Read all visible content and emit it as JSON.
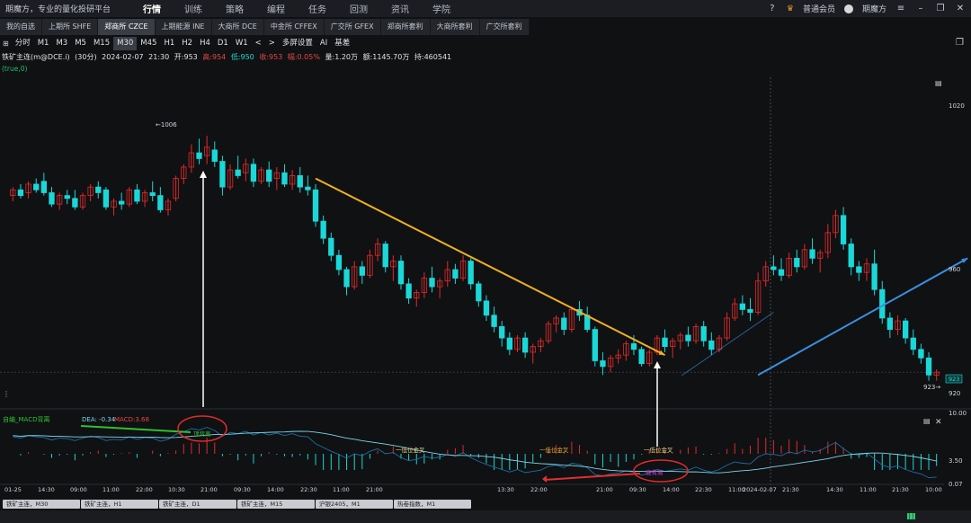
{
  "app": {
    "brand": "期魔方，专业的量化投研平台",
    "menu": [
      "行情",
      "训练",
      "策略",
      "编程",
      "任务",
      "回测",
      "资讯",
      "学院"
    ],
    "active_menu": "行情",
    "membership": "普通会员",
    "username": "期魔方"
  },
  "exchange_tabs": [
    "我的自选",
    "上期所 SHFE",
    "郑商所 CZCE",
    "上期能源 INE",
    "大商所 DCE",
    "中金所 CFFEX",
    "广交所 GFEX",
    "郑商所套利",
    "大商所套利",
    "广交所套利"
  ],
  "active_exchange_tab": "郑商所 CZCE",
  "periods": [
    "分时",
    "M1",
    "M3",
    "M5",
    "M15",
    "M30",
    "M45",
    "H1",
    "H2",
    "H4",
    "D1",
    "W1"
  ],
  "active_period": "M30",
  "period_extras": {
    "prev": "<",
    "next": ">",
    "multi": "多屏设置",
    "ai": "AI",
    "spread": "基差"
  },
  "quote": {
    "symbol": "铁矿主连(m@DCE.i)",
    "interval": "(30分)",
    "date": "2024-02-07",
    "time": "21:30",
    "open_label": "开:953",
    "high_label": "高:954",
    "low_label": "低:950",
    "close_label": "收:953",
    "change_label": "幅:0.05%",
    "volume_label": "量:1.20万",
    "amount_label": "额:1145.70万",
    "oi_label": "持:460541"
  },
  "params_label": "(true,0)",
  "price_axis": {
    "labels": [
      "1020",
      "960",
      "920"
    ],
    "last_tag": "923",
    "low_marker": "923",
    "high_marker": "←1006"
  },
  "indicator": {
    "name": "自编_MACD背离",
    "dea_label": "DEA: -0.34",
    "macd_label": "MACD:3.68",
    "axis_labels": [
      "10.00",
      "3.50",
      "0.07"
    ],
    "annotations": [
      "顶背离",
      "一低位金叉",
      "一低位金叉",
      "一低位金叉",
      "底背离"
    ]
  },
  "time_axis": [
    "01-25",
    "14:30",
    "09:00",
    "11:00",
    "22:00",
    "10:30",
    "21:00",
    "09:30",
    "14:00",
    "22:30",
    "11:00",
    "21:00",
    "13:30",
    "22:00",
    "21:00",
    "09:30",
    "14:00",
    "22:30",
    "11:00",
    "2024-02-07",
    "21:30",
    "14:30",
    "11:00",
    "21:30",
    "10:00"
  ],
  "bottom_tabs": [
    "铁矿主连，M30",
    "铁矿主连，H1",
    "铁矿主连，D1",
    "铁矿主连，M15",
    "沪银2405，M1",
    "热卷指数，M1"
  ],
  "colors": {
    "up": "#e02b2b",
    "down": "#1ad8d8",
    "bg": "#101113",
    "accent": "#2f9ad0"
  },
  "chart_data": {
    "type": "candlestick",
    "title": "铁矿主连(m@DCE.i) (30分)",
    "ylim": [
      918,
      1024
    ],
    "candles": [
      [
        985,
        988,
        983,
        987
      ],
      [
        987,
        989,
        984,
        985
      ],
      [
        986,
        990,
        984,
        989
      ],
      [
        989,
        991,
        986,
        987
      ],
      [
        990,
        993,
        985,
        986
      ],
      [
        986,
        988,
        981,
        982
      ],
      [
        982,
        986,
        980,
        985
      ],
      [
        985,
        987,
        982,
        984
      ],
      [
        984,
        987,
        980,
        981
      ],
      [
        981,
        986,
        980,
        985
      ],
      [
        985,
        989,
        983,
        988
      ],
      [
        988,
        990,
        984,
        986
      ],
      [
        987,
        988,
        980,
        981
      ],
      [
        981,
        984,
        978,
        983
      ],
      [
        983,
        986,
        980,
        982
      ],
      [
        982,
        988,
        981,
        987
      ],
      [
        987,
        989,
        982,
        983
      ],
      [
        983,
        987,
        981,
        986
      ],
      [
        986,
        990,
        983,
        985
      ],
      [
        985,
        988,
        979,
        980
      ],
      [
        980,
        984,
        978,
        983
      ],
      [
        984,
        992,
        983,
        991
      ],
      [
        991,
        996,
        989,
        995
      ],
      [
        995,
        1003,
        993,
        1000
      ],
      [
        1000,
        1005,
        996,
        998
      ],
      [
        999,
        1006,
        996,
        1002
      ],
      [
        1001,
        1004,
        995,
        997
      ],
      [
        997,
        999,
        985,
        988
      ],
      [
        988,
        996,
        987,
        994
      ],
      [
        994,
        999,
        991,
        992
      ],
      [
        993,
        998,
        990,
        996
      ],
      [
        996,
        998,
        988,
        990
      ],
      [
        990,
        995,
        989,
        994
      ],
      [
        994,
        997,
        988,
        990
      ],
      [
        991,
        995,
        987,
        993
      ],
      [
        993,
        996,
        988,
        989
      ],
      [
        989,
        994,
        987,
        992
      ],
      [
        992,
        995,
        986,
        988
      ],
      [
        988,
        992,
        985,
        987
      ],
      [
        987,
        989,
        974,
        976
      ],
      [
        976,
        978,
        968,
        970
      ],
      [
        970,
        972,
        962,
        964
      ],
      [
        964,
        966,
        957,
        959
      ],
      [
        959,
        960,
        950,
        953
      ],
      [
        953,
        962,
        952,
        960
      ],
      [
        960,
        962,
        954,
        957
      ],
      [
        957,
        966,
        956,
        964
      ],
      [
        964,
        970,
        962,
        968
      ],
      [
        968,
        969,
        958,
        960
      ],
      [
        960,
        964,
        955,
        962
      ],
      [
        962,
        964,
        952,
        954
      ],
      [
        954,
        956,
        947,
        949
      ],
      [
        949,
        952,
        946,
        951
      ],
      [
        951,
        958,
        949,
        956
      ],
      [
        956,
        960,
        951,
        953
      ],
      [
        953,
        956,
        949,
        955
      ],
      [
        955,
        962,
        953,
        959
      ],
      [
        959,
        961,
        954,
        956
      ],
      [
        956,
        964,
        955,
        962
      ],
      [
        962,
        963,
        952,
        954
      ],
      [
        954,
        955,
        946,
        948
      ],
      [
        948,
        950,
        941,
        943
      ],
      [
        943,
        946,
        937,
        939
      ],
      [
        939,
        941,
        932,
        935
      ],
      [
        935,
        937,
        929,
        931
      ],
      [
        931,
        936,
        930,
        935
      ],
      [
        935,
        937,
        928,
        930
      ],
      [
        930,
        933,
        926,
        932
      ],
      [
        932,
        935,
        930,
        934
      ],
      [
        934,
        941,
        933,
        940
      ],
      [
        940,
        943,
        937,
        942
      ],
      [
        942,
        944,
        936,
        938
      ],
      [
        938,
        946,
        937,
        945
      ],
      [
        945,
        948,
        941,
        943
      ],
      [
        943,
        946,
        937,
        938
      ],
      [
        938,
        939,
        925,
        927
      ],
      [
        927,
        930,
        922,
        925
      ],
      [
        925,
        929,
        923,
        928
      ],
      [
        928,
        931,
        926,
        929
      ],
      [
        929,
        934,
        927,
        933
      ],
      [
        933,
        936,
        929,
        931
      ],
      [
        931,
        932,
        925,
        926
      ],
      [
        926,
        931,
        925,
        930
      ],
      [
        930,
        936,
        929,
        935
      ],
      [
        935,
        938,
        930,
        932
      ],
      [
        932,
        935,
        928,
        934
      ],
      [
        934,
        937,
        931,
        936
      ],
      [
        936,
        939,
        932,
        934
      ],
      [
        934,
        940,
        933,
        939
      ],
      [
        939,
        941,
        932,
        934
      ],
      [
        934,
        937,
        929,
        931
      ],
      [
        931,
        936,
        930,
        935
      ],
      [
        935,
        944,
        934,
        942
      ],
      [
        942,
        949,
        941,
        947
      ],
      [
        947,
        950,
        943,
        945
      ],
      [
        945,
        949,
        941,
        944
      ],
      [
        944,
        958,
        943,
        955
      ],
      [
        955,
        962,
        953,
        960
      ],
      [
        960,
        964,
        957,
        959
      ],
      [
        959,
        963,
        955,
        957
      ],
      [
        957,
        965,
        956,
        963
      ],
      [
        963,
        966,
        958,
        960
      ],
      [
        960,
        968,
        959,
        966
      ],
      [
        966,
        970,
        961,
        963
      ],
      [
        963,
        966,
        958,
        965
      ],
      [
        965,
        975,
        963,
        972
      ],
      [
        972,
        980,
        970,
        978
      ],
      [
        978,
        981,
        966,
        968
      ],
      [
        968,
        970,
        957,
        960
      ],
      [
        960,
        962,
        955,
        958
      ],
      [
        958,
        963,
        955,
        961
      ],
      [
        961,
        966,
        950,
        952
      ],
      [
        952,
        955,
        940,
        942
      ],
      [
        942,
        944,
        935,
        938
      ],
      [
        938,
        943,
        936,
        941
      ],
      [
        941,
        942,
        933,
        935
      ],
      [
        935,
        938,
        929,
        931
      ],
      [
        931,
        933,
        926,
        928
      ],
      [
        928,
        930,
        920,
        922
      ],
      [
        922,
        924,
        920,
        923
      ]
    ],
    "trendlines": [
      {
        "color": "#f0b020",
        "from": [
          39,
          991
        ],
        "to": [
          84,
          929
        ]
      },
      {
        "color": "#3a8fe0",
        "from": [
          96,
          922
        ],
        "to": [
          123,
          963
        ]
      }
    ]
  }
}
